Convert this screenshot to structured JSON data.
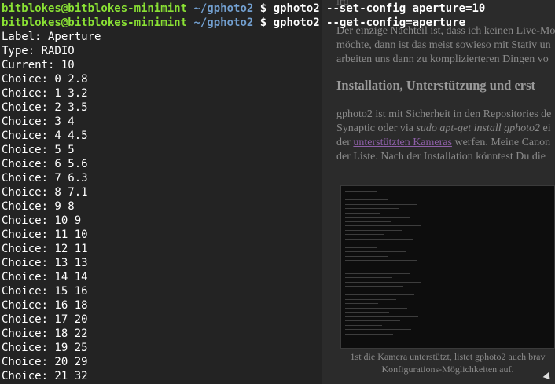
{
  "terminal": {
    "prompts": [
      {
        "user_host": "bitblokes@bitblokes-minimint",
        "path": "~/gphoto2",
        "symbol": "$",
        "command": "gphoto2 --set-config aperture=10"
      },
      {
        "user_host": "bitblokes@bitblokes-minimint",
        "path": "~/gphoto2",
        "symbol": "$",
        "command": "gphoto2 --get-config=aperture"
      }
    ],
    "output": [
      "Label: Aperture",
      "Type: RADIO",
      "Current: 10",
      "Choice: 0 2.8",
      "Choice: 1 3.2",
      "Choice: 2 3.5",
      "Choice: 3 4",
      "Choice: 4 4.5",
      "Choice: 5 5",
      "Choice: 6 5.6",
      "Choice: 7 6.3",
      "Choice: 8 7.1",
      "Choice: 9 8",
      "Choice: 10 9",
      "Choice: 11 10",
      "Choice: 12 11",
      "Choice: 13 13",
      "Choice: 14 14",
      "Choice: 15 16",
      "Choice: 16 18",
      "Choice: 17 20",
      "Choice: 18 22",
      "Choice: 19 25",
      "Choice: 20 29",
      "Choice: 21 32"
    ],
    "colors": {
      "user_host": "#8ae234",
      "path": "#729fcf",
      "text": "#ffffff",
      "background": "#232323"
    }
  },
  "article": {
    "line_0": "ird",
    "line_1": "Der einzige Nachteil ist, dass ich keinen Live-Mo",
    "line_2": "möchte, dann ist das meist sowieso mit Stativ un",
    "line_3": "arbeiten uns dann zu komplizierteren Dingen vo",
    "heading": "Installation, Unterstützung und erst",
    "p2_line_1": "gphoto2 ist mit Sicherheit in den Repositories de",
    "p2_line_2_pre": "Synaptic oder via ",
    "p2_line_2_em": "sudo apt-get install gphoto2",
    "p2_line_2_post": " ei",
    "p2_line_3_pre": "der ",
    "p2_line_3_link": "unterstützten Kameras",
    "p2_line_3_post": " werfen. Meine Canon",
    "p2_line_4": "der Liste. Nach der Installation könntest Du die",
    "caption_line_1": "1st die Kamera unterstützt, listet gphoto2 auch brav",
    "caption_line_2": "Konfigurations-Möglichkeiten auf.",
    "link_color": "#8e5fa8"
  }
}
